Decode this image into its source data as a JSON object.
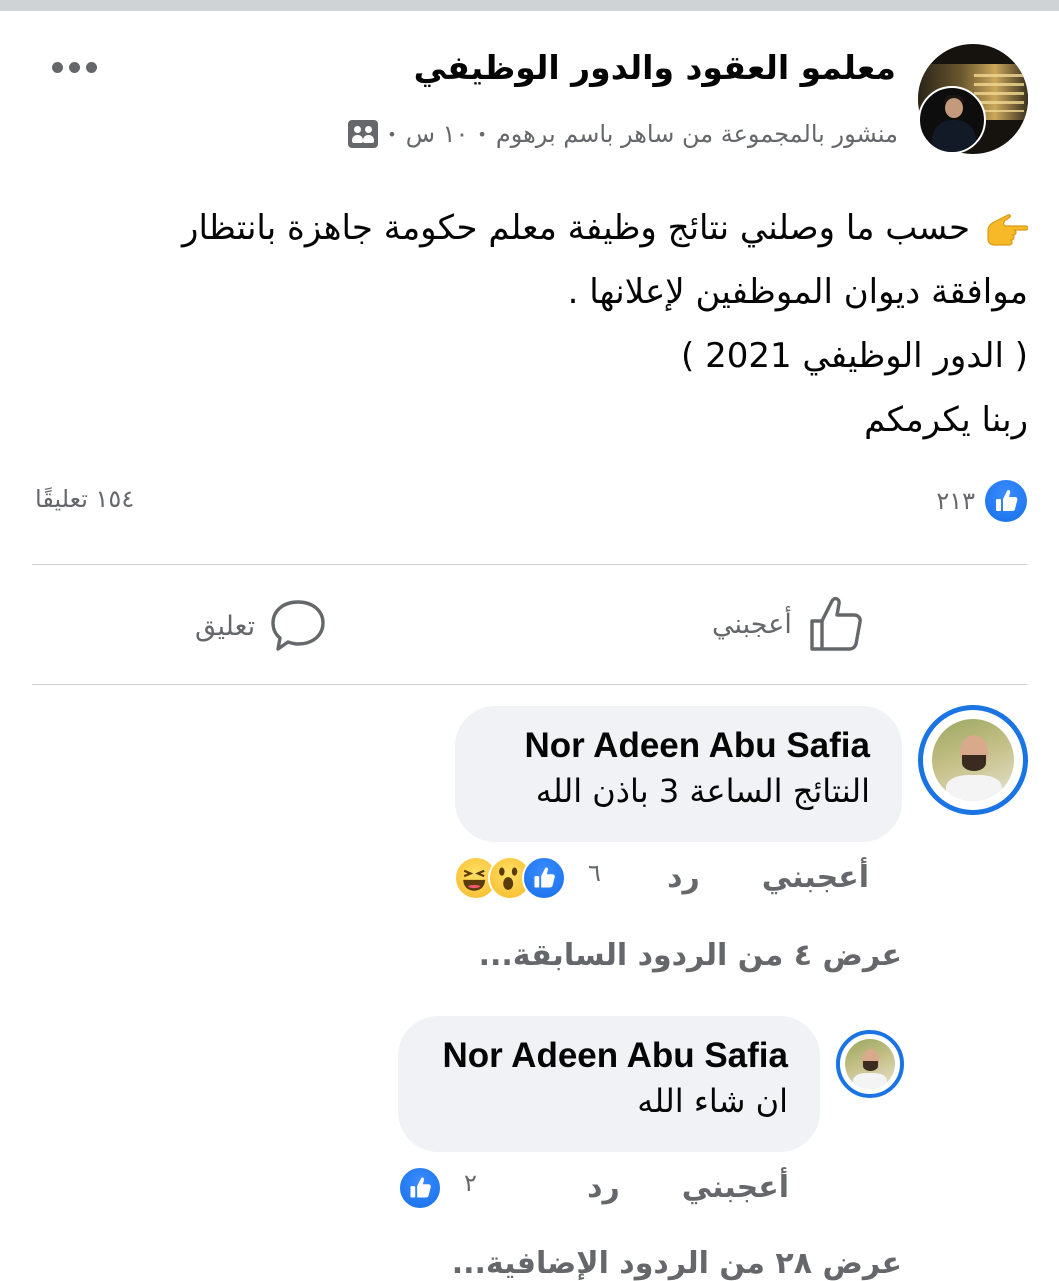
{
  "post": {
    "group_name": "معلمو العقود والدور الوظيفي",
    "meta": {
      "text": "منشور بالمجموعة من ساهر باسم برهوم",
      "time": "١٠ س",
      "separator": "•"
    },
    "lines": [
      "حسب ما وصلني نتائج وظيفة معلم حكومة جاهزة بانتظار",
      "موافقة ديوان الموظفين لإعلانها .",
      "( الدور الوظيفي 2021 )",
      "ربنا يكرمكم"
    ],
    "likes_count": "٢١٣",
    "comments_count": "١٥٤ تعليقًا",
    "actions": {
      "like": "أعجبني",
      "comment": "تعليق"
    }
  },
  "comments": [
    {
      "author": "Nor Adeen Abu Safia",
      "text": "النتائج الساعة 3 باذن الله",
      "like_label": "أعجبني",
      "reply_label": "رد",
      "reaction_count": "٦"
    }
  ],
  "view_previous": "عرض ٤ من الردود السابقة...",
  "replies": [
    {
      "author": "Nor Adeen Abu Safia",
      "text": "ان شاء الله",
      "like_label": "أعجبني",
      "reply_label": "رد",
      "reaction_count": "٢"
    }
  ],
  "view_more": "عرض ٢٨ من الردود الإضافية..."
}
